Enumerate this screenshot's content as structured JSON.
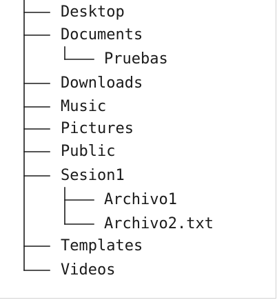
{
  "tree": {
    "items": [
      {
        "label": "Desktop"
      },
      {
        "label": "Documents",
        "children": [
          {
            "label": "Pruebas"
          }
        ]
      },
      {
        "label": "Downloads"
      },
      {
        "label": "Music"
      },
      {
        "label": "Pictures"
      },
      {
        "label": "Public"
      },
      {
        "label": "Sesion1",
        "children": [
          {
            "label": "Archivo1"
          },
          {
            "label": "Archivo2.txt"
          }
        ]
      },
      {
        "label": "Templates"
      },
      {
        "label": "Videos"
      }
    ]
  }
}
